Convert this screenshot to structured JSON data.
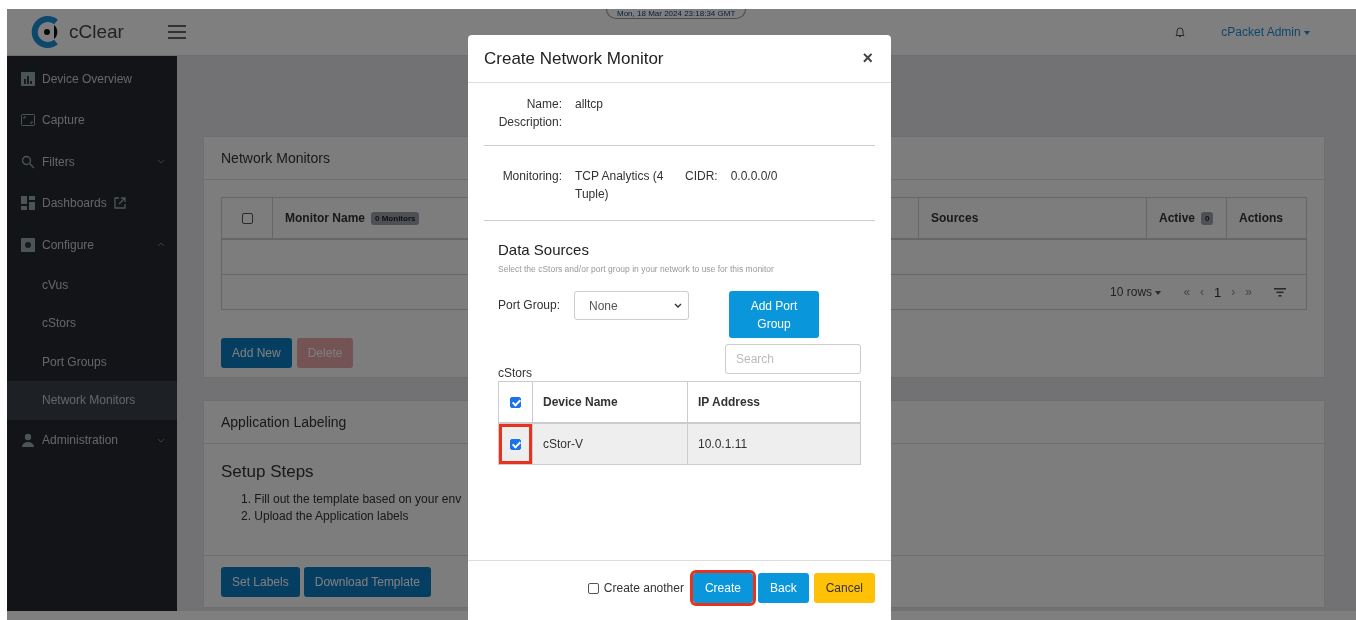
{
  "timestamp": "Mon, 18 Mar 2024 23:18:34 GMT",
  "header": {
    "logo": "cClear",
    "user": "cPacket Admin"
  },
  "sidebar": {
    "items": [
      {
        "label": "Device Overview",
        "selected": false
      },
      {
        "label": "Capture",
        "selected": false
      },
      {
        "label": "Filters",
        "selected": false,
        "expanded": false
      },
      {
        "label": "Dashboards",
        "selected": false,
        "external_link": true
      },
      {
        "label": "Configure",
        "selected": false,
        "expanded": true,
        "children": [
          {
            "label": "cVus",
            "selected": false
          },
          {
            "label": "cStors",
            "selected": false
          },
          {
            "label": "Port Groups",
            "selected": false
          },
          {
            "label": "Network Monitors",
            "selected": true
          }
        ]
      },
      {
        "label": "Administration",
        "selected": false,
        "expanded": false
      }
    ]
  },
  "monitors_card": {
    "title": "Network Monitors",
    "table": {
      "select_all_checked": false,
      "columns": [
        {
          "label": "Monitor Name",
          "badge": "0 Monitors"
        },
        {
          "label": "Sources"
        },
        {
          "label": "Active",
          "badge": "0"
        },
        {
          "label": "Actions"
        }
      ]
    },
    "pager": {
      "rows": "10 rows",
      "first": "«",
      "prev": "‹",
      "page": "1",
      "next": "›",
      "last": "»"
    },
    "buttons": [
      {
        "label": "Add New",
        "disabled": false
      },
      {
        "label": "Delete",
        "disabled": true
      }
    ]
  },
  "labeling_card": {
    "title": "Application Labeling",
    "heading": "Setup Steps",
    "steps": [
      "1. Fill out the template based on your env",
      "2. Upload the Application labels"
    ],
    "buttons": [
      {
        "label": "Set Labels",
        "disabled": false
      },
      {
        "label": "Download Template",
        "disabled": false
      }
    ]
  },
  "modal": {
    "title": "Create Network Monitor",
    "close": "×",
    "fields": [
      {
        "label": "Name:",
        "value": "alltcp"
      },
      {
        "label": "Description:"
      }
    ],
    "monitoring": {
      "label": "Monitoring:",
      "value": "TCP Analytics (4 Tuple)"
    },
    "cidr": {
      "label": "CIDR:",
      "value": "0.0.0.0/0"
    },
    "data_sources": {
      "title": "Data Sources",
      "hint": "Select the cStors and/or port group in your network to use for this monitor",
      "port_group": {
        "label": "Port Group:",
        "value": "None"
      },
      "add_button": "Add Port Group",
      "cstors_label": "cStors",
      "search": {
        "placeholder": "Search"
      },
      "table": {
        "select_all_checked": true,
        "columns": [
          "Device Name",
          "IP Address"
        ],
        "rows": [
          {
            "checked": true,
            "highlighted": true,
            "cells": [
              "cStor-V",
              "10.0.1.11"
            ]
          }
        ]
      }
    },
    "footer": {
      "create_another": {
        "label": "Create another",
        "checked": false
      },
      "buttons": [
        {
          "label": "Create",
          "kind": "primary",
          "highlighted": true
        },
        {
          "label": "Back",
          "kind": "primary",
          "highlighted": false
        },
        {
          "label": "Cancel",
          "kind": "warning",
          "highlighted": false
        }
      ]
    }
  }
}
